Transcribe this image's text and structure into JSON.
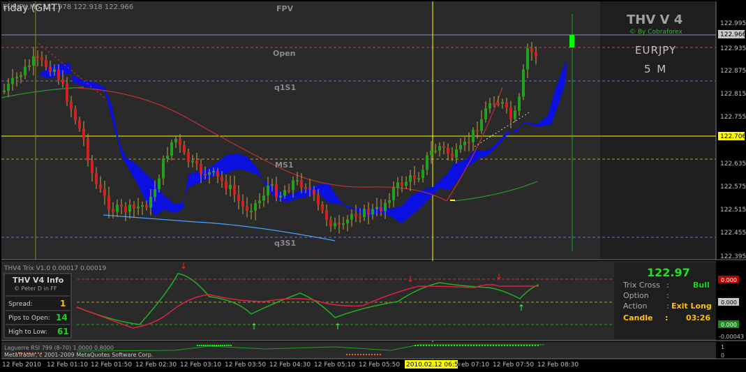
{
  "main_chart": {
    "header": "EURJPY,M5  122.978 122.918 122.966",
    "day_label": "riday  (GMT)",
    "price_scale": [
      "122.995",
      "122.935",
      "122.875",
      "122.815",
      "122.755",
      "122.695",
      "122.635",
      "122.575",
      "122.515",
      "122.455",
      "122.395"
    ],
    "bid_marker": "122.966",
    "crosshair_price": "122.706",
    "levels": {
      "fpv": "FPV",
      "open": "Open",
      "q1s1": "q1S1",
      "ms1": "MS1",
      "q3s1": "q3S1"
    }
  },
  "panel": {
    "title": "THV V 4",
    "credit": "© By Cobraforex",
    "symbol": "EURJPY",
    "timeframe": "5 M"
  },
  "trix": {
    "header": "THV4 Trix V1.0 0.00017 0.00019",
    "scale": [
      "0.000",
      "0.000",
      "0.000",
      "-0.00043"
    ],
    "info_title": "THV  V4  Info",
    "info_credit": "© Peter D in FF",
    "spread_label": "Spread:",
    "spread_value": "1",
    "pips_label": "Pips to Open:",
    "pips_value": "14",
    "hl_label": "High to Low:",
    "hl_value": "61",
    "price": "122.97",
    "trix_cross_label": "Trix Cross",
    "trix_cross_value": "Bull",
    "option_label": "Option",
    "action_label": "Action",
    "action_value": "Exit Long",
    "candle_label": "Candle",
    "candle_value": "03:26",
    "colon": ":"
  },
  "laguerre": {
    "header": "Laguerre RSI 799 (8-70) 1.0000 0.8000",
    "copyright": "MetaTrader, c 2001-2009 MetaQuotes Software Corp.",
    "scale": [
      "1",
      "0"
    ]
  },
  "time_axis": [
    "12 Feb 2010",
    "12 Feb 01:10",
    "12 Feb 01:50",
    "12 Feb 02:30",
    "12 Feb 03:10",
    "12 Feb 03:50",
    "12 Feb 04:30",
    "12 Feb 05:10",
    "12 Feb 05:50",
    "12 Feb 07:10",
    "12 Feb 07:50",
    "12 Feb 08:30"
  ],
  "time_cursor": "2010.02.12 06:55",
  "colors": {
    "bull": "#1fa31f",
    "bear": "#d42020",
    "cloud": "#0a10e0",
    "yellow": "#ffff00",
    "lime": "#00ff00",
    "gold": "#ffc000"
  }
}
